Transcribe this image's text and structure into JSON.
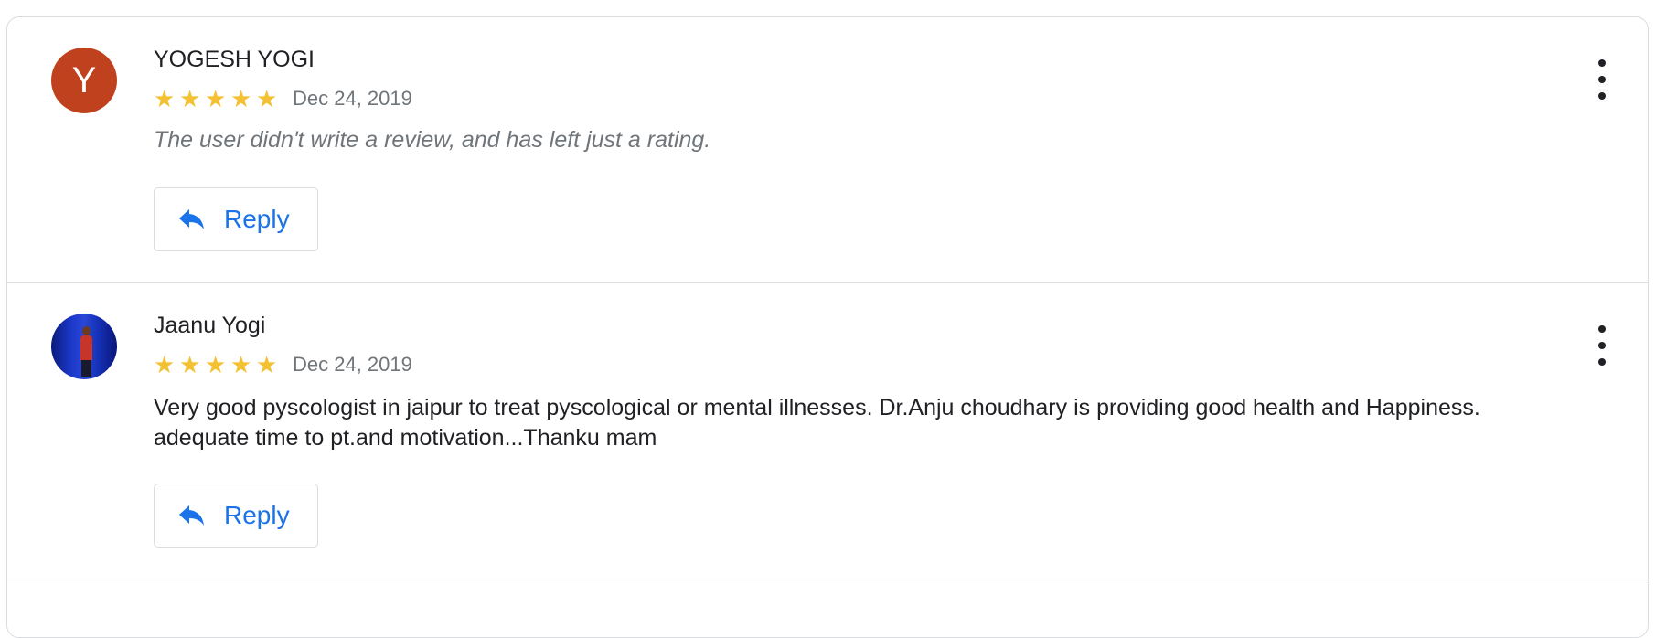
{
  "reviews": [
    {
      "avatar_letter": "Y",
      "avatar_color": "#bf411e",
      "name": "YOGESH YOGI",
      "rating": 5,
      "date": "Dec 24, 2019",
      "text": "The user didn't write a review, and has left just a rating.",
      "reply_label": "Reply"
    },
    {
      "avatar_letter": "",
      "name": "Jaanu Yogi",
      "rating": 5,
      "date": "Dec 24, 2019",
      "text": "Very good pyscologist in jaipur to treat pyscological or mental illnesses. Dr.Anju choudhary is providing good health and Happiness. adequate time to pt.and motivation...Thanku mam",
      "reply_label": "Reply"
    }
  ],
  "colors": {
    "star": "#f4c133",
    "link_blue": "#1a73e8",
    "border": "#dadce0",
    "muted_text": "#70757a"
  },
  "icons": {
    "star": "star-icon",
    "reply": "reply-arrow-icon",
    "more": "more-vert-icon"
  }
}
